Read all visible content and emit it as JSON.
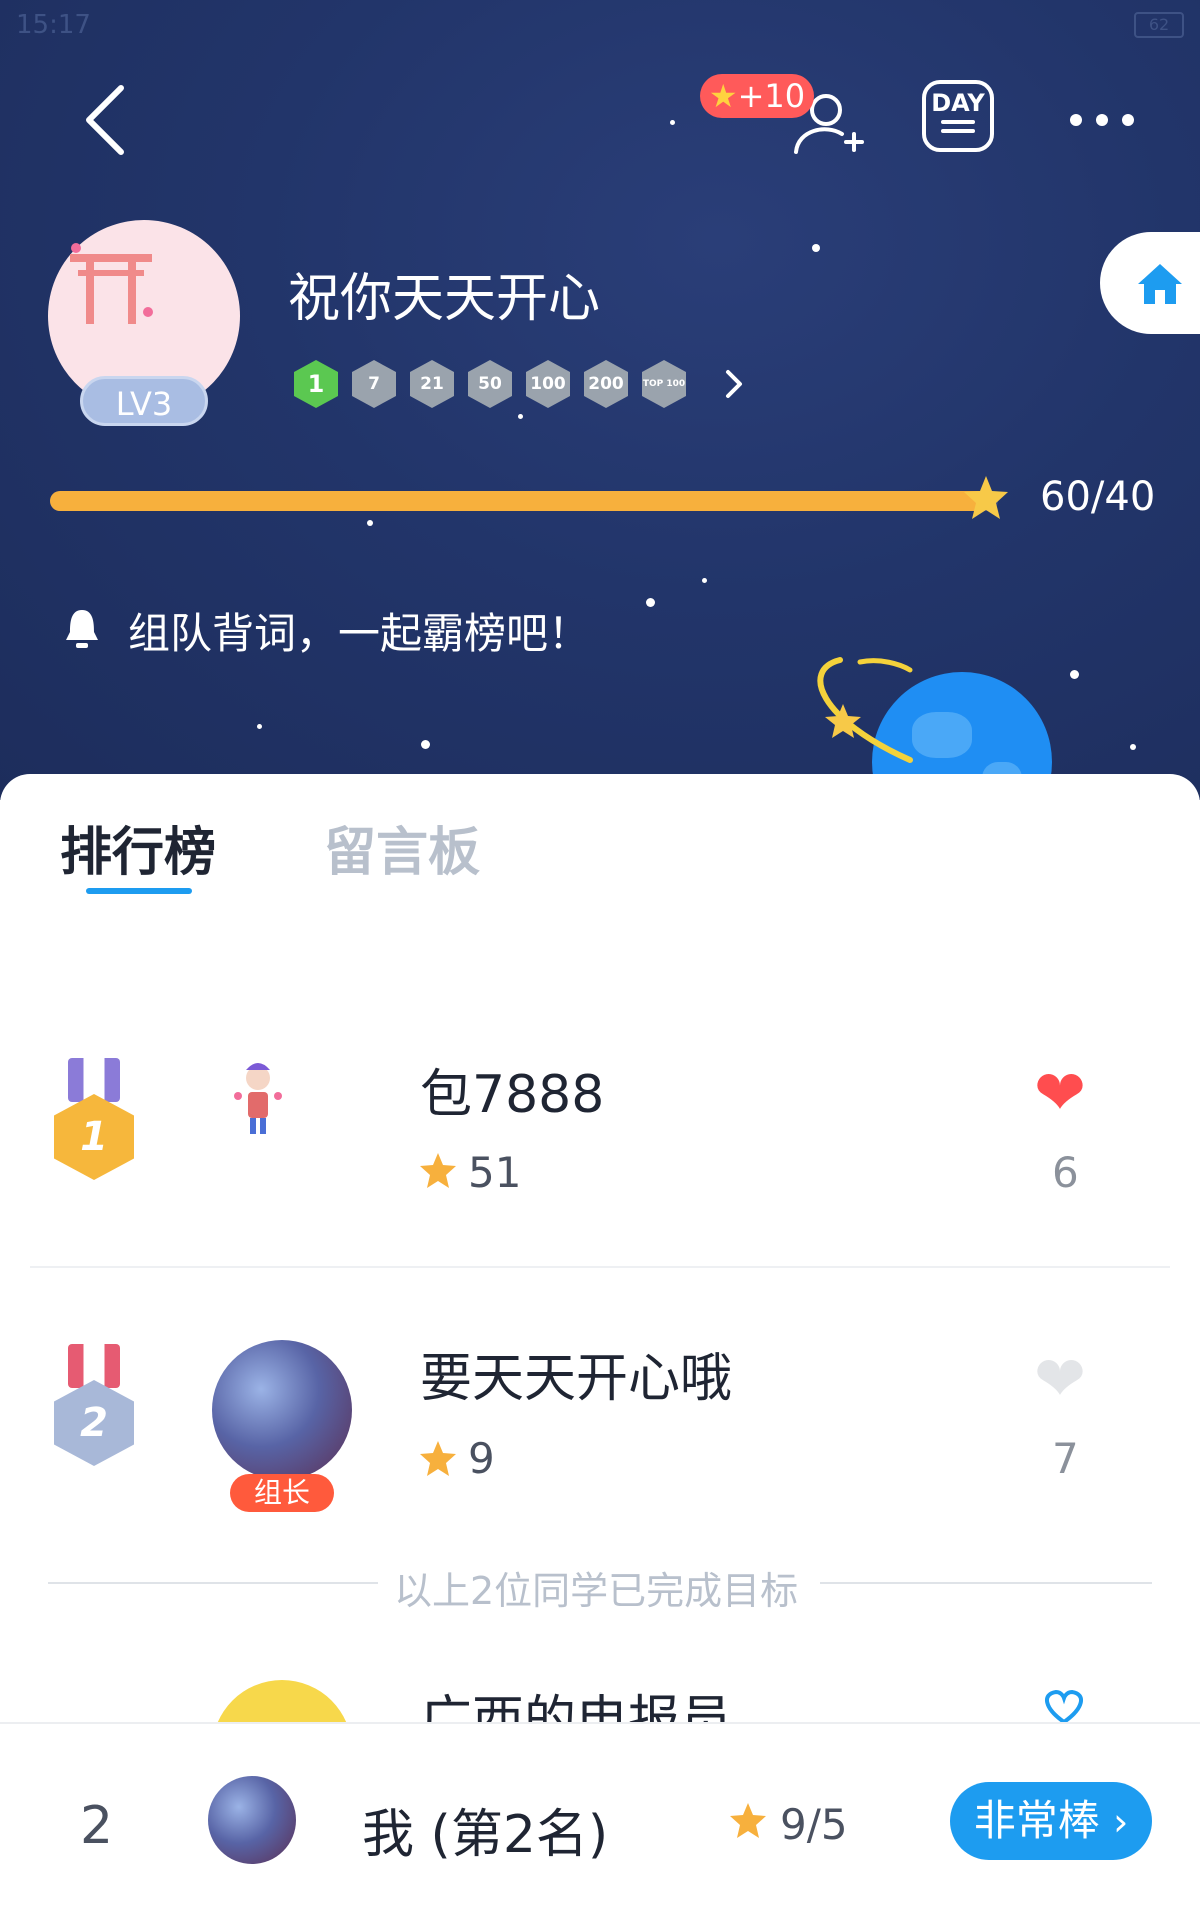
{
  "status_bar": {
    "time": "15:17",
    "battery": "62"
  },
  "header": {
    "bonus_badge": "+10",
    "day_label": "DAY",
    "username": "祝你天天开心",
    "level": "LV3",
    "milestones": [
      "1",
      "7",
      "21",
      "50",
      "100",
      "200",
      "TOP 100"
    ],
    "progress": {
      "text": "60/40",
      "fraction": 1.0
    },
    "notice": "组队背词，一起霸榜吧！"
  },
  "tabs": {
    "ranking": "排行榜",
    "board": "留言板"
  },
  "rows": [
    {
      "rank": "1",
      "name": "包7888",
      "score": "51",
      "likes": "6"
    },
    {
      "rank": "2",
      "name": "要天天开心哦",
      "score": "9",
      "likes": "7",
      "role": "组长"
    },
    {
      "name": "广西的电报员"
    }
  ],
  "completed_text": "以上2位同学已完成目标",
  "footer": {
    "rank": "2",
    "name": "我 (第2名)",
    "score": "9/5",
    "cta": "非常棒"
  },
  "colors": {
    "accent": "#1d9cf0",
    "header_bg": "#22356a",
    "progress": "#f7b03d",
    "heart_active": "#ff4d4f",
    "heart_inactive": "#e3e5e8"
  }
}
